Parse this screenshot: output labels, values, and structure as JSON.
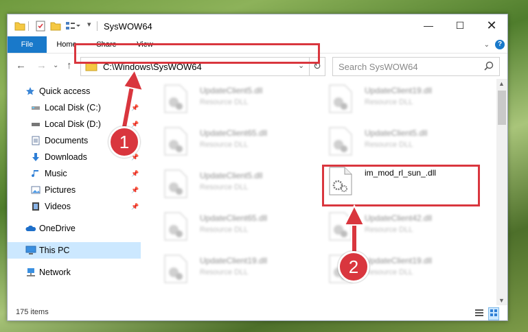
{
  "window": {
    "title": "SysWOW64"
  },
  "ribbon": {
    "tabs": [
      "File",
      "Home",
      "Share",
      "View"
    ],
    "help": "?"
  },
  "address": {
    "path": "C:\\Windows\\SysWOW64"
  },
  "search": {
    "placeholder": "Search SysWOW64"
  },
  "nav": {
    "items": [
      {
        "label": "Quick access",
        "icon": "star-icon"
      },
      {
        "label": "Local Disk (C:)",
        "icon": "drive-icon",
        "pinned": true
      },
      {
        "label": "Local Disk (D:)",
        "icon": "drive-icon",
        "pinned": true
      },
      {
        "label": "Documents",
        "icon": "documents-icon",
        "pinned": true
      },
      {
        "label": "Downloads",
        "icon": "downloads-icon",
        "pinned": true
      },
      {
        "label": "Music",
        "icon": "music-icon",
        "pinned": true
      },
      {
        "label": "Pictures",
        "icon": "pictures-icon",
        "pinned": true
      },
      {
        "label": "Videos",
        "icon": "videos-icon",
        "pinned": true
      },
      {
        "label": "OneDrive",
        "icon": "onedrive-icon"
      },
      {
        "label": "This PC",
        "icon": "this-pc-icon",
        "selected": true
      },
      {
        "label": "Network",
        "icon": "network-icon"
      }
    ]
  },
  "files": [
    {
      "name": "UpdateClient5.dll",
      "type": "Resource DLL"
    },
    {
      "name": "UpdateClient19.dll",
      "type": "Resource DLL"
    },
    {
      "name": "UpdateClient65.dll",
      "type": "Resource DLL"
    },
    {
      "name": "UpdateClient5.dll",
      "type": "Resource DLL"
    },
    {
      "name": "UpdateClient5.dll",
      "type": "Resource DLL"
    },
    {
      "name": "im_mod_rl_sun_.dll",
      "type": ""
    },
    {
      "name": "UpdateClient65.dll",
      "type": "Resource DLL"
    },
    {
      "name": "UpdateClient42.dll",
      "type": "Resource DLL"
    },
    {
      "name": "UpdateClient19.dll",
      "type": "Resource DLL"
    },
    {
      "name": "UpdateClient19.dll",
      "type": "Resource DLL"
    }
  ],
  "status": {
    "items_count": "175 items"
  },
  "annotations": {
    "step1": "1",
    "step2": "2",
    "color": "#d9363e"
  }
}
